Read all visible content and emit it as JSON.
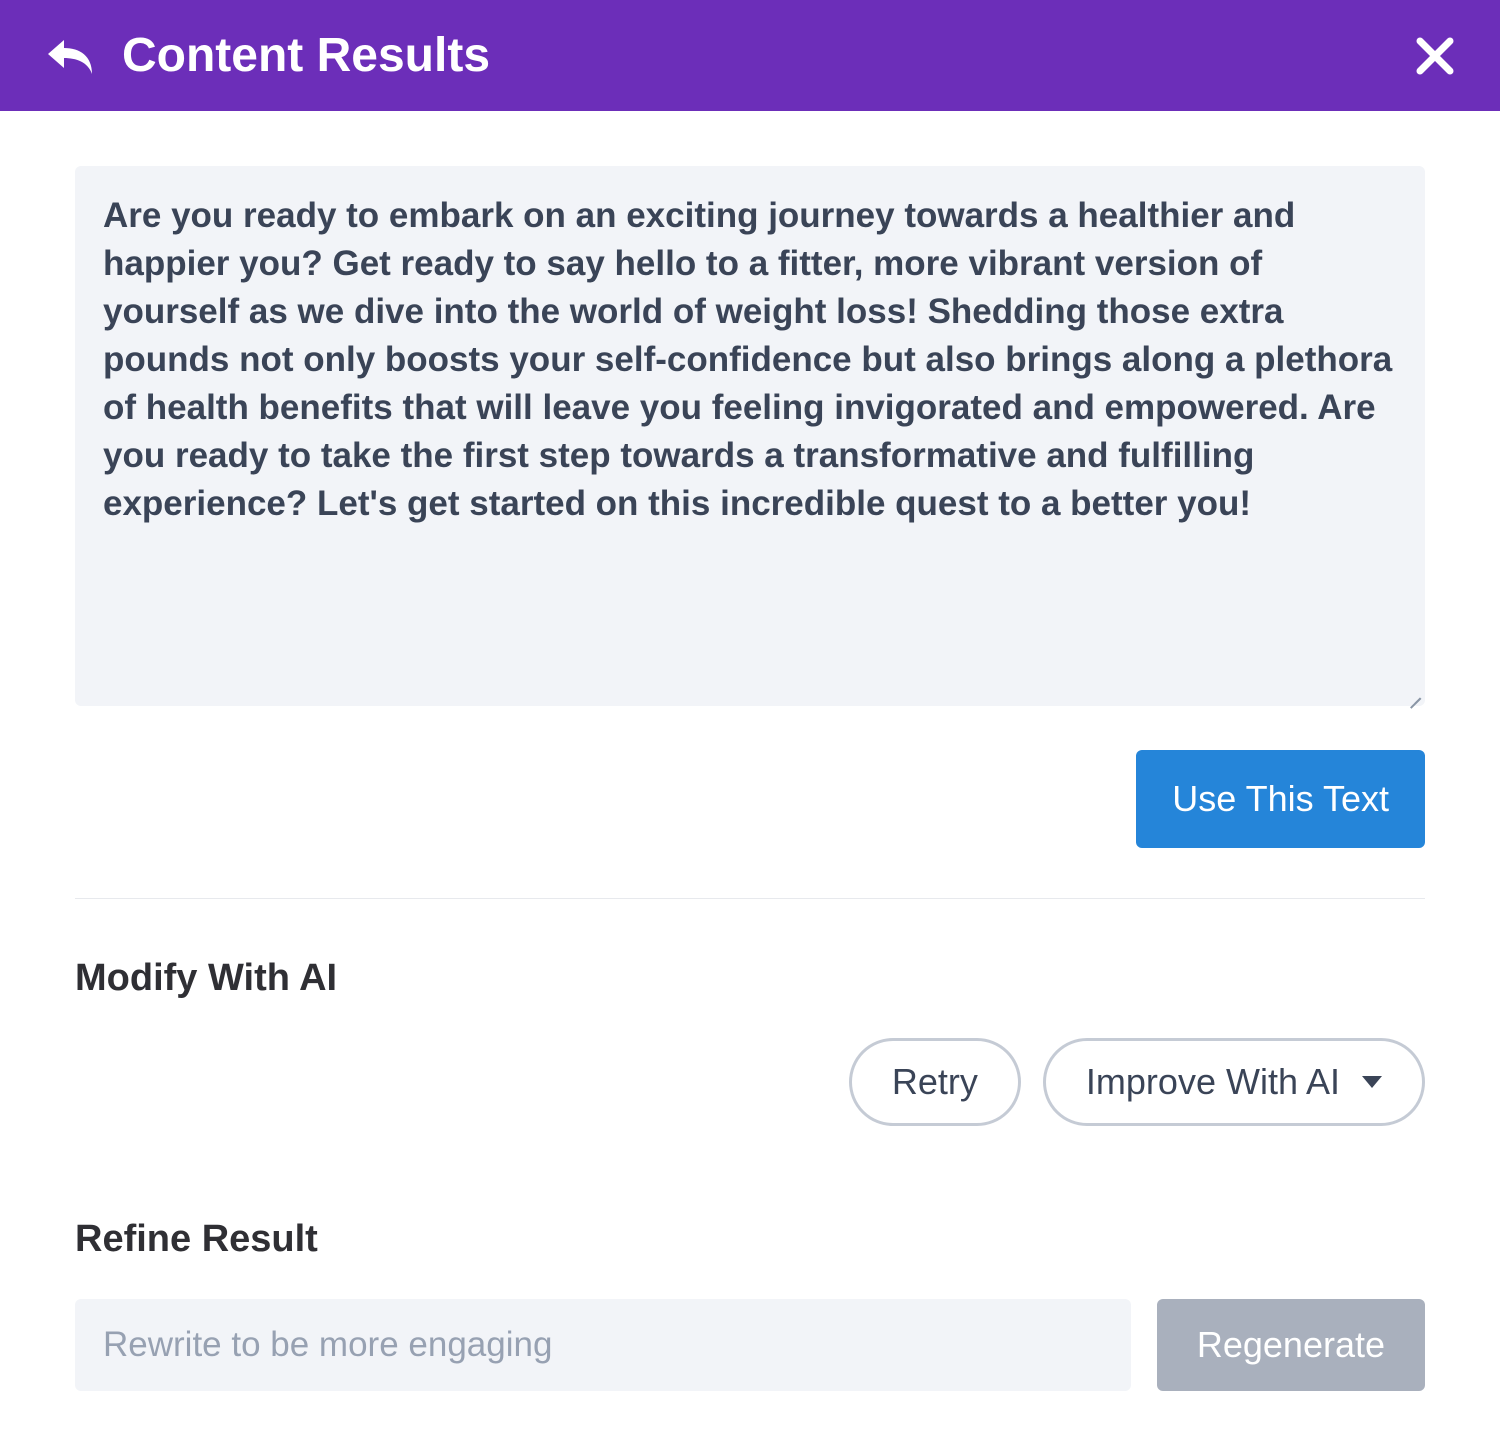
{
  "header": {
    "title": "Content Results"
  },
  "result": {
    "text": "Are you ready to embark on an exciting journey towards a healthier and happier you? Get ready to say hello to a fitter, more vibrant version of yourself as we dive into the world of weight loss! Shedding those extra pounds not only boosts your self-confidence but also brings along a plethora of health benefits that will leave you feeling invigorated and empowered. Are you ready to take the first step towards a transformative and fulfilling experience? Let's get started on this incredible quest to a better you!"
  },
  "actions": {
    "use_text": "Use This Text"
  },
  "modify": {
    "title": "Modify With AI",
    "retry": "Retry",
    "improve": "Improve With AI"
  },
  "refine": {
    "title": "Refine Result",
    "placeholder": "Rewrite to be more engaging",
    "regenerate": "Regenerate"
  }
}
